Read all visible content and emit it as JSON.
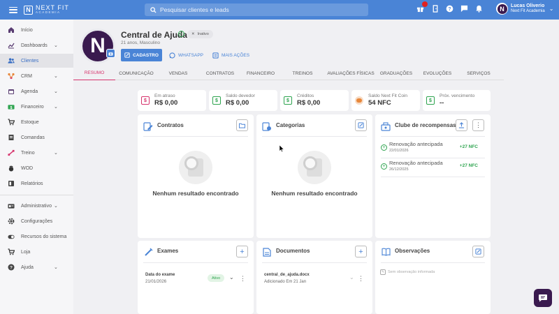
{
  "header": {
    "brand_name": "NEXT FIT",
    "brand_sub": "ACADEMIA",
    "search_placeholder": "Pesquisar clientes e leads",
    "user_name": "Lucas Oliverio",
    "user_academy": "Next Fit Academia"
  },
  "sidebar": {
    "items": [
      {
        "label": "Início",
        "icon": "home-icon"
      },
      {
        "label": "Dashboards",
        "icon": "chart-icon"
      },
      {
        "label": "Clientes",
        "icon": "users-icon"
      },
      {
        "label": "CRM",
        "icon": "crm-icon"
      },
      {
        "label": "Agenda",
        "icon": "calendar-icon"
      },
      {
        "label": "Financeiro",
        "icon": "money-icon"
      },
      {
        "label": "Estoque",
        "icon": "cart-icon"
      },
      {
        "label": "Comandas",
        "icon": "receipt-icon"
      },
      {
        "label": "Treino",
        "icon": "dumbbell-icon"
      },
      {
        "label": "WOD",
        "icon": "kettlebell-icon"
      },
      {
        "label": "Relatórios",
        "icon": "report-icon"
      },
      {
        "label": "Administrativo",
        "icon": "id-card-icon"
      },
      {
        "label": "Configurações",
        "icon": "gear-icon"
      },
      {
        "label": "Recursos do sistema",
        "icon": "toggle-icon"
      },
      {
        "label": "Loja",
        "icon": "store-icon"
      },
      {
        "label": "Ajuda",
        "icon": "help-icon"
      }
    ],
    "active": "Clientes"
  },
  "profile": {
    "name": "Central de Ajuda",
    "status": "Inativo",
    "subtitle": "21 anos, Masculino",
    "btn_cadastro": "CADASTRO",
    "btn_whatsapp": "WHATSAPP",
    "btn_mais": "MAIS AÇÕES"
  },
  "tabs": [
    "RESUMO",
    "COMUNICAÇÃO",
    "VENDAS",
    "CONTRATOS",
    "FINANCEIRO",
    "TREINOS",
    "AVALIAÇÕES FÍSICAS",
    "GRADUAÇÕES",
    "EVOLUÇÕES",
    "SERVIÇOS"
  ],
  "active_tab": "RESUMO",
  "stats": [
    {
      "label": "Em atraso",
      "value": "R$ 0,00",
      "color": "#d6336c"
    },
    {
      "label": "Saldo devedor",
      "value": "R$ 0,00",
      "color": "#2ea44f"
    },
    {
      "label": "Créditos",
      "value": "R$ 0,00",
      "color": "#2ea44f"
    },
    {
      "label": "Saldo Next Fit Coin",
      "value": "54 NFC",
      "color": "#e8873a"
    },
    {
      "label": "Próx. vencimento",
      "value": "--",
      "color": "#2ea44f"
    }
  ],
  "panels": {
    "contratos": {
      "title": "Contratos",
      "empty": "Nenhum resultado encontrado"
    },
    "categorias": {
      "title": "Categorias",
      "empty": "Nenhum resultado encontrado"
    },
    "clube": {
      "title": "Clube de recompensas",
      "items": [
        {
          "title": "Renovação antecipada",
          "date": "22/01/2026",
          "amount": "+27 NFC"
        },
        {
          "title": "Renovação antecipada",
          "date": "26/12/2025",
          "amount": "+27 NFC"
        }
      ]
    },
    "exames": {
      "title": "Exames",
      "date_label": "Data do exame",
      "date": "21/01/2026",
      "status": "Ativo"
    },
    "documentos": {
      "title": "Documentos",
      "file": "central_de_ajuda.docx",
      "added": "Adicionado Em 21 Jan"
    },
    "observacoes": {
      "title": "Observações",
      "empty": "Sem observação informada"
    }
  },
  "colors": {
    "primary": "#4a84d6",
    "accent": "#d6336c",
    "success": "#2ea44f",
    "brand_purple": "#3a1a4f"
  }
}
